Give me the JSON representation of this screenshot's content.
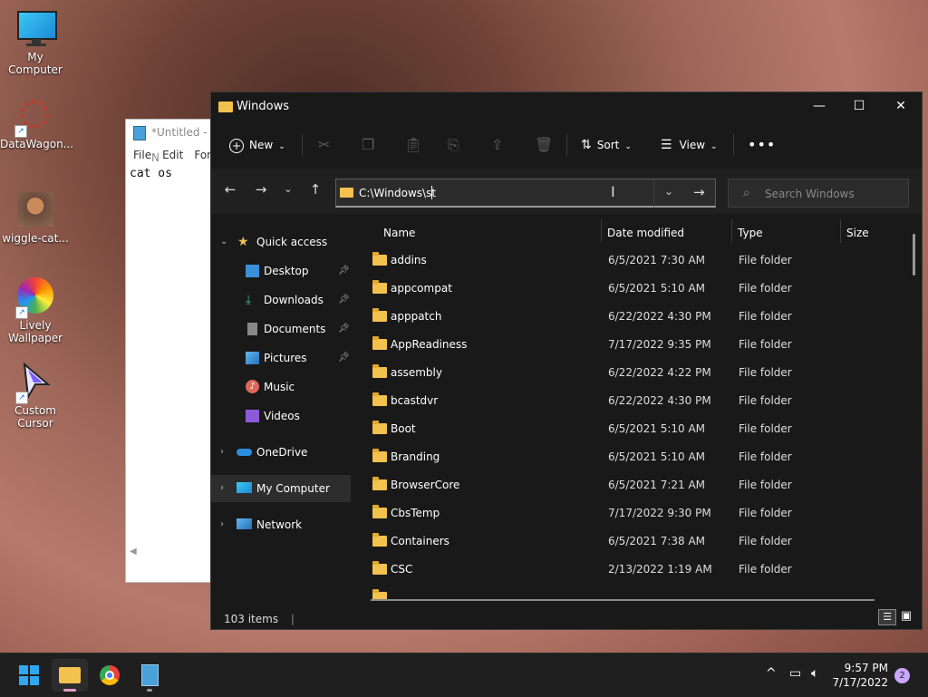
{
  "desktop": {
    "icons": [
      {
        "label": "My Computer",
        "icon": "monitor-icon"
      },
      {
        "label": "DataWagon...",
        "icon": "gear-shortcut-icon"
      },
      {
        "label": "wiggle-cat...",
        "icon": "cat-image-icon"
      },
      {
        "label": "Lively Wallpaper",
        "icon": "lively-wallpaper-icon"
      },
      {
        "label": "Custom Cursor",
        "icon": "cursor-icon"
      }
    ]
  },
  "notepad": {
    "title": "*Untitled - N",
    "menu": [
      "File",
      "Edit",
      "Forr"
    ],
    "content": "cat os"
  },
  "explorer": {
    "title": "Windows",
    "toolbar": {
      "new_label": "New",
      "sort_label": "Sort",
      "view_label": "View"
    },
    "address": "C:\\Windows\\st",
    "search_placeholder": "Search Windows",
    "sidebar": {
      "quick_access": "Quick access",
      "pinned": [
        "Desktop",
        "Downloads",
        "Documents",
        "Pictures"
      ],
      "others": [
        "Music",
        "Videos"
      ],
      "onedrive": "OneDrive",
      "my_computer": "My Computer",
      "network": "Network"
    },
    "columns": {
      "name": "Name",
      "date": "Date modified",
      "type": "Type",
      "size": "Size"
    },
    "rows": [
      {
        "name": "addins",
        "date": "6/5/2021 7:30 AM",
        "type": "File folder"
      },
      {
        "name": "appcompat",
        "date": "6/5/2021 5:10 AM",
        "type": "File folder"
      },
      {
        "name": "apppatch",
        "date": "6/22/2022 4:30 PM",
        "type": "File folder"
      },
      {
        "name": "AppReadiness",
        "date": "7/17/2022 9:35 PM",
        "type": "File folder"
      },
      {
        "name": "assembly",
        "date": "6/22/2022 4:22 PM",
        "type": "File folder"
      },
      {
        "name": "bcastdvr",
        "date": "6/22/2022 4:30 PM",
        "type": "File folder"
      },
      {
        "name": "Boot",
        "date": "6/5/2021 5:10 AM",
        "type": "File folder"
      },
      {
        "name": "Branding",
        "date": "6/5/2021 5:10 AM",
        "type": "File folder"
      },
      {
        "name": "BrowserCore",
        "date": "6/5/2021 7:21 AM",
        "type": "File folder"
      },
      {
        "name": "CbsTemp",
        "date": "7/17/2022 9:30 PM",
        "type": "File folder"
      },
      {
        "name": "Containers",
        "date": "6/5/2021 7:38 AM",
        "type": "File folder"
      },
      {
        "name": "CSC",
        "date": "2/13/2022 1:19 AM",
        "type": "File folder"
      }
    ],
    "status": "103 items"
  },
  "taskbar": {
    "time": "9:57 PM",
    "date": "7/17/2022",
    "notifications": "2"
  }
}
